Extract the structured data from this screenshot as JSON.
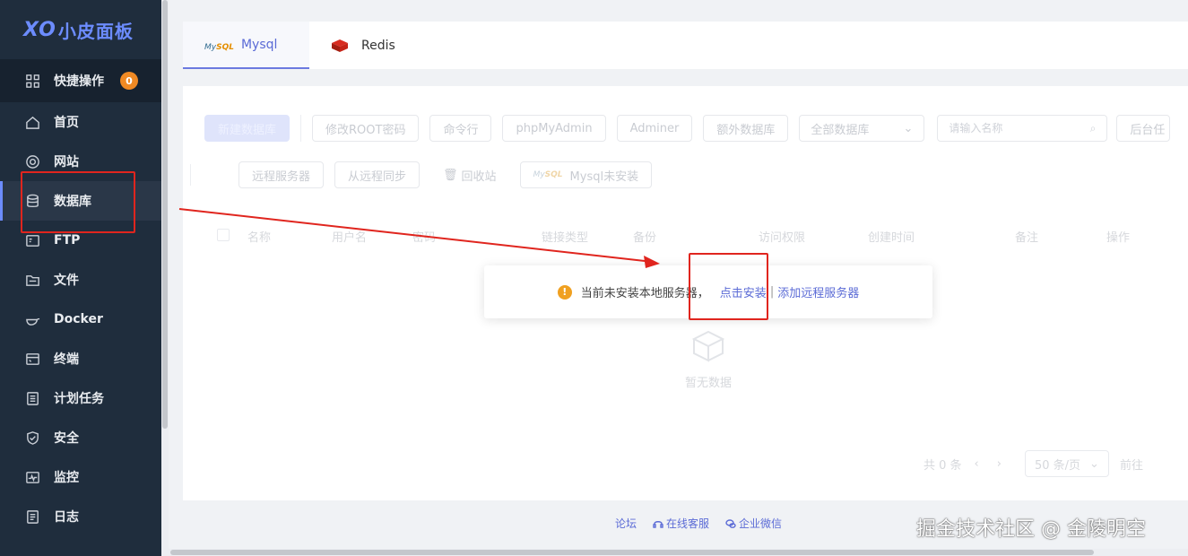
{
  "app": {
    "logo_xo": "XO",
    "logo_text": "小皮面板"
  },
  "sidebar": {
    "quick": {
      "label": "快捷操作",
      "badge": "0"
    },
    "items": [
      {
        "label": "首页"
      },
      {
        "label": "网站"
      },
      {
        "label": "数据库"
      },
      {
        "label": "FTP"
      },
      {
        "label": "文件"
      },
      {
        "label": "Docker"
      },
      {
        "label": "终端"
      },
      {
        "label": "计划任务"
      },
      {
        "label": "安全"
      },
      {
        "label": "监控"
      },
      {
        "label": "日志"
      }
    ]
  },
  "tabs": [
    {
      "label": "Mysql",
      "logo_main": "My",
      "logo_accent": "SQL"
    },
    {
      "label": "Redis"
    }
  ],
  "toolbar": {
    "new_db": "新建数据库",
    "change_root": "修改ROOT密码",
    "cmd": "命令行",
    "phpmyadmin": "phpMyAdmin",
    "adminer": "Adminer",
    "extra_db": "额外数据库",
    "all_db": "全部数据库",
    "search_placeholder": "请输入名称",
    "backend_task": "后台任",
    "remote_server": "远程服务器",
    "sync_remote": "从远程同步",
    "recycle": "回收站",
    "mysql_not_installed": "Mysql未安装"
  },
  "table": {
    "columns": [
      "名称",
      "用户名",
      "密码",
      "链接类型",
      "备份",
      "访问权限",
      "创建时间",
      "备注",
      "操作"
    ],
    "empty": "暂无数据"
  },
  "pager": {
    "total": "共 0 条",
    "page_size": "50 条/页",
    "goto": "前往"
  },
  "alert": {
    "message": "当前未安装本地服务器，",
    "install_link": "点击安装",
    "pipe": "|",
    "add_remote_link": "添加远程服务器"
  },
  "footer": {
    "forum": "论坛",
    "support": "在线客服",
    "wechat": "企业微信"
  },
  "watermark": "掘金技术社区 @ 金陵明空",
  "colors": {
    "sidebar_bg": "#1f2d3d",
    "accent": "#6c8cff",
    "badge": "#f08a24",
    "annotation": "#e0251e"
  }
}
